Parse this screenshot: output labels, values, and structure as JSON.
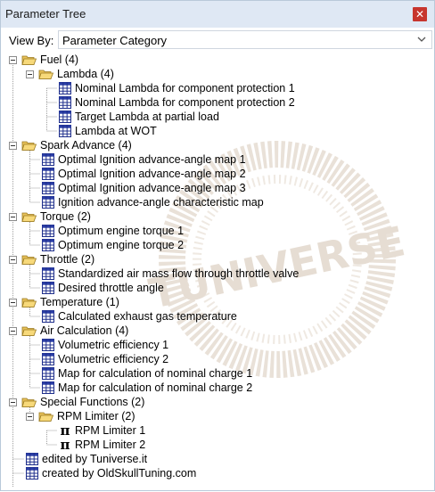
{
  "window": {
    "title": "Parameter Tree",
    "close_icon": "close-icon"
  },
  "viewby": {
    "label": "View By:",
    "value": "Parameter Category"
  },
  "tree": {
    "fuel": {
      "label": "Fuel (4)"
    },
    "lambda": {
      "label": "Lambda (4)"
    },
    "lambda_items": [
      "Nominal Lambda for component protection 1",
      "Nominal Lambda for component protection 2",
      "Target Lambda at partial load",
      "Lambda at WOT"
    ],
    "spark": {
      "label": "Spark Advance (4)"
    },
    "spark_items": [
      "Optimal Ignition advance-angle map 1",
      "Optimal Ignition advance-angle map 2",
      "Optimal Ignition advance-angle map 3",
      "Ignition advance-angle characteristic map"
    ],
    "torque": {
      "label": "Torque (2)"
    },
    "torque_items": [
      "Optimum engine torque 1",
      "Optimum engine torque 2"
    ],
    "throttle": {
      "label": "Throttle (2)"
    },
    "throttle_items": [
      "Standardized air mass flow through throttle valve",
      "Desired throttle angle"
    ],
    "temperature": {
      "label": "Temperature (1)"
    },
    "temperature_items": [
      "Calculated exhaust gas temperature"
    ],
    "air": {
      "label": "Air Calculation (4)"
    },
    "air_items": [
      "Volumetric efficiency 1",
      "Volumetric efficiency 2",
      "Map for calculation of nominal charge 1",
      "Map for calculation of nominal charge 2"
    ],
    "special": {
      "label": "Special Functions (2)"
    },
    "rpm": {
      "label": "RPM Limiter (2)"
    },
    "rpm_items": [
      "RPM Limiter 1",
      "RPM Limiter 2"
    ],
    "root_items": [
      "edited by Tuniverse.it",
      "created by OldSkullTuning.com"
    ]
  },
  "watermark": {
    "text": "TUNIVERSE"
  }
}
